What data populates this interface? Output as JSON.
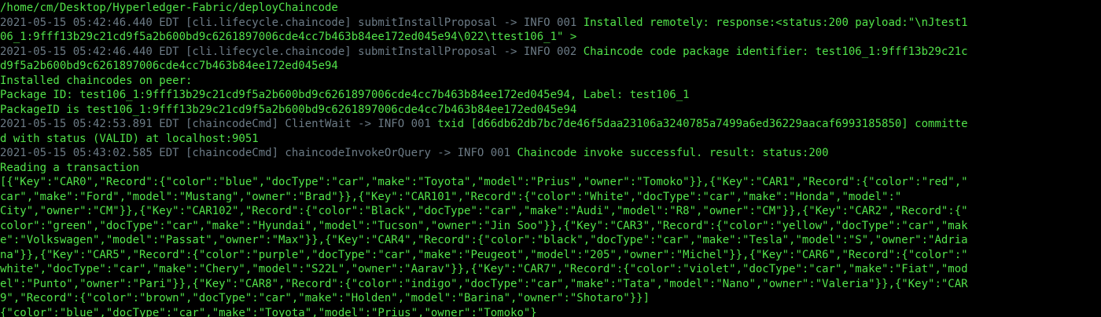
{
  "terminal": {
    "colors": {
      "background": "#000000",
      "text": "#52e34a",
      "log_prefix": "#6c7b86"
    },
    "lines": [
      {
        "dim": "",
        "text": "/home/cm/Desktop/Hyperledger-Fabric/deployChaincode"
      },
      {
        "dim": "2021-05-15 05:42:46.440 EDT [cli.lifecycle.chaincode] submitInstallProposal -> INFO 001 ",
        "text": "Installed remotely: response:<status:200 payload:\"\\nJtest1"
      },
      {
        "dim": "",
        "text": "06_1:9fff13b29c21cd9f5a2b600bd9c6261897006cde4cc7b463b84ee172ed045e94\\022\\ttest106_1\" >"
      },
      {
        "dim": "2021-05-15 05:42:46.440 EDT [cli.lifecycle.chaincode] submitInstallProposal -> INFO 002 ",
        "text": "Chaincode code package identifier: test106_1:9fff13b29c21c"
      },
      {
        "dim": "",
        "text": "d9f5a2b600bd9c6261897006cde4cc7b463b84ee172ed045e94"
      },
      {
        "dim": "",
        "text": "Installed chaincodes on peer:"
      },
      {
        "dim": "",
        "text": "Package ID: test106_1:9fff13b29c21cd9f5a2b600bd9c6261897006cde4cc7b463b84ee172ed045e94, Label: test106_1"
      },
      {
        "dim": "",
        "text": "PackageID is test106_1:9fff13b29c21cd9f5a2b600bd9c6261897006cde4cc7b463b84ee172ed045e94"
      },
      {
        "dim": "2021-05-15 05:42:53.891 EDT [chaincodeCmd] ClientWait -> INFO 001 ",
        "text": "txid [d66db62db7bc7de46f5daa23106a3240785a7499a6ed36229aacaf6993185850] committe"
      },
      {
        "dim": "",
        "text": "d with status (VALID) at localhost:9051"
      },
      {
        "dim": "2021-05-15 05:43:02.585 EDT [chaincodeCmd] chaincodeInvokeOrQuery -> INFO 001 ",
        "text": "Chaincode invoke successful. result: status:200"
      },
      {
        "dim": "",
        "text": "Reading a transaction"
      },
      {
        "dim": "",
        "text": "[{\"Key\":\"CAR0\",\"Record\":{\"color\":\"blue\",\"docType\":\"car\",\"make\":\"Toyota\",\"model\":\"Prius\",\"owner\":\"Tomoko\"}},{\"Key\":\"CAR1\",\"Record\":{\"color\":\"red\",\""
      },
      {
        "dim": "",
        "text": "car\",\"make\":\"Ford\",\"model\":\"Mustang\",\"owner\":\"Brad\"}},{\"Key\":\"CAR101\",\"Record\":{\"color\":\"White\",\"docType\":\"car\",\"make\":\"Honda\",\"model\":\""
      },
      {
        "dim": "",
        "text": "City\",\"owner\":\"CM\"}},{\"Key\":\"CAR102\",\"Record\":{\"color\":\"Black\",\"docType\":\"car\",\"make\":\"Audi\",\"model\":\"R8\",\"owner\":\"CM\"}},{\"Key\":\"CAR2\",\"Record\":{\""
      },
      {
        "dim": "",
        "text": "color\":\"green\",\"docType\":\"car\",\"make\":\"Hyundai\",\"model\":\"Tucson\",\"owner\":\"Jin Soo\"}},{\"Key\":\"CAR3\",\"Record\":{\"color\":\"yellow\",\"docType\":\"car\",\"mak"
      },
      {
        "dim": "",
        "text": "e\":\"Volkswagen\",\"model\":\"Passat\",\"owner\":\"Max\"}},{\"Key\":\"CAR4\",\"Record\":{\"color\":\"black\",\"docType\":\"car\",\"make\":\"Tesla\",\"model\":\"S\",\"owner\":\"Adria"
      },
      {
        "dim": "",
        "text": "na\"}},{\"Key\":\"CAR5\",\"Record\":{\"color\":\"purple\",\"docType\":\"car\",\"make\":\"Peugeot\",\"model\":\"205\",\"owner\":\"Michel\"}},{\"Key\":\"CAR6\",\"Record\":{\"color\":\""
      },
      {
        "dim": "",
        "text": "white\",\"docType\":\"car\",\"make\":\"Chery\",\"model\":\"S22L\",\"owner\":\"Aarav\"}},{\"Key\":\"CAR7\",\"Record\":{\"color\":\"violet\",\"docType\":\"car\",\"make\":\"Fiat\",\"mod"
      },
      {
        "dim": "",
        "text": "el\":\"Punto\",\"owner\":\"Pari\"}},{\"Key\":\"CAR8\",\"Record\":{\"color\":\"indigo\",\"docType\":\"car\",\"make\":\"Tata\",\"model\":\"Nano\",\"owner\":\"Valeria\"}},{\"Key\":\"CAR"
      },
      {
        "dim": "",
        "text": "9\",\"Record\":{\"color\":\"brown\",\"docType\":\"car\",\"make\":\"Holden\",\"model\":\"Barina\",\"owner\":\"Shotaro\"}}]"
      },
      {
        "dim": "",
        "text": "{\"color\":\"blue\",\"docType\":\"car\",\"make\":\"Toyota\",\"model\":\"Prius\",\"owner\":\"Tomoko\"}"
      }
    ]
  }
}
